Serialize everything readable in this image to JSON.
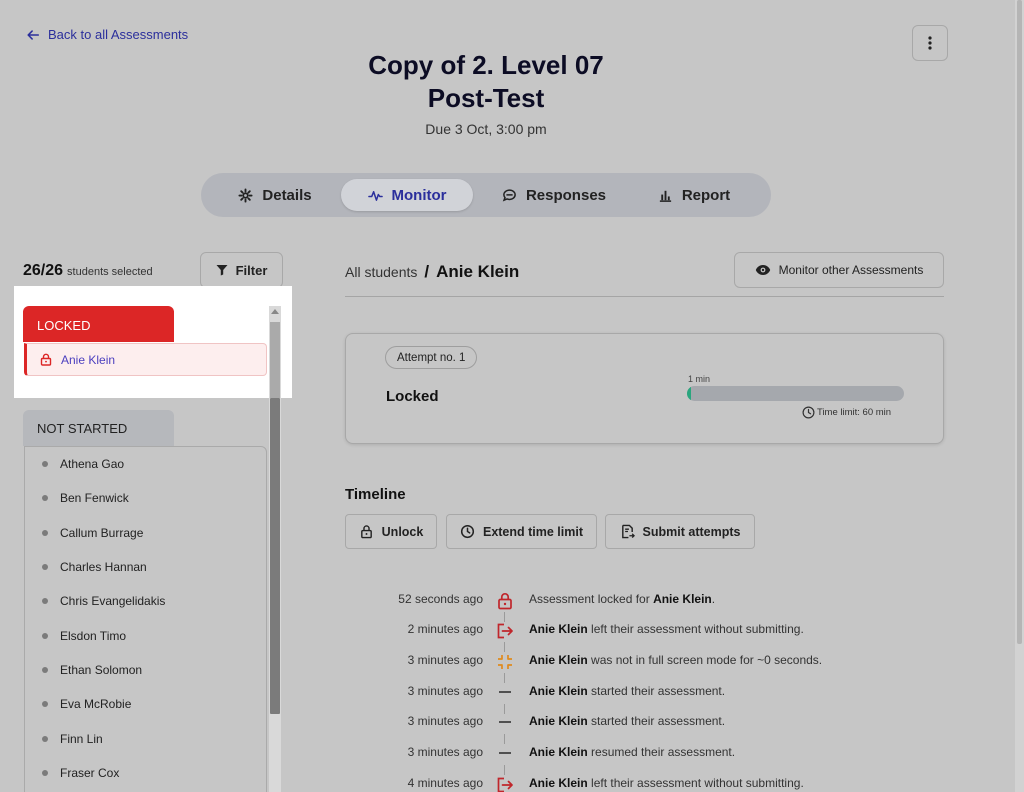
{
  "nav": {
    "back_label": "Back to all Assessments"
  },
  "assessment": {
    "title_line1": "Copy of 2. Level 07",
    "title_line2": "Post-Test",
    "due": "Due 3 Oct, 3:00 pm"
  },
  "tabs": [
    {
      "label": "Details",
      "icon": "gear-icon",
      "active": false
    },
    {
      "label": "Monitor",
      "icon": "pulse-icon",
      "active": true
    },
    {
      "label": "Responses",
      "icon": "chat-icon",
      "active": false
    },
    {
      "label": "Report",
      "icon": "bar-chart-icon",
      "active": false
    }
  ],
  "sidebar": {
    "selected_count": "26/26",
    "selected_label": "students selected",
    "filter_label": "Filter",
    "groups": {
      "locked": {
        "label": "LOCKED",
        "students": [
          "Anie Klein"
        ]
      },
      "not_started": {
        "label": "NOT STARTED",
        "students": [
          "Athena Gao",
          "Ben Fenwick",
          "Callum Burrage",
          "Charles Hannan",
          "Chris Evangelidakis",
          "Elsdon Timo",
          "Ethan Solomon",
          "Eva McRobie",
          "Finn Lin",
          "Fraser Cox"
        ]
      }
    }
  },
  "breadcrumb": {
    "all": "All students",
    "separator": "/",
    "current": "Anie Klein"
  },
  "monitor_other_label": "Monitor other Assessments",
  "attempt": {
    "pill": "Attempt no. 1",
    "status": "Locked",
    "elapsed_label": "1 min",
    "progress_fraction": 0.017,
    "time_limit": "Time limit: 60 min"
  },
  "timeline": {
    "title": "Timeline",
    "buttons": {
      "unlock": "Unlock",
      "extend": "Extend time limit",
      "submit": "Submit attempts"
    },
    "events": [
      {
        "time": "52  seconds ago",
        "icon": "lock-icon",
        "pre": "Assessment locked for ",
        "name": "Anie Klein",
        "post": "."
      },
      {
        "time": "2  minutes ago",
        "icon": "exit-icon",
        "pre": "",
        "name": "Anie Klein",
        "post": " left their assessment without submitting."
      },
      {
        "time": "3  minutes ago",
        "icon": "fullscreen-exit-icon",
        "pre": "",
        "name": "Anie Klein",
        "post": " was not in full screen mode for ~0 seconds."
      },
      {
        "time": "3  minutes ago",
        "icon": "dash-icon",
        "pre": "",
        "name": "Anie Klein",
        "post": " started their assessment."
      },
      {
        "time": "3  minutes ago",
        "icon": "dash-icon",
        "pre": "",
        "name": "Anie Klein",
        "post": " started their assessment."
      },
      {
        "time": "3  minutes ago",
        "icon": "dash-icon",
        "pre": "",
        "name": "Anie Klein",
        "post": " resumed their assessment."
      },
      {
        "time": "4  minutes ago",
        "icon": "exit-icon",
        "pre": "",
        "name": "Anie Klein",
        "post": " left their assessment without submitting."
      }
    ]
  },
  "colors": {
    "accent": "#2b2f9c",
    "locked_red": "#dc2626",
    "warning_orange": "#e08a1e",
    "progress_green": "#2aa67e"
  }
}
